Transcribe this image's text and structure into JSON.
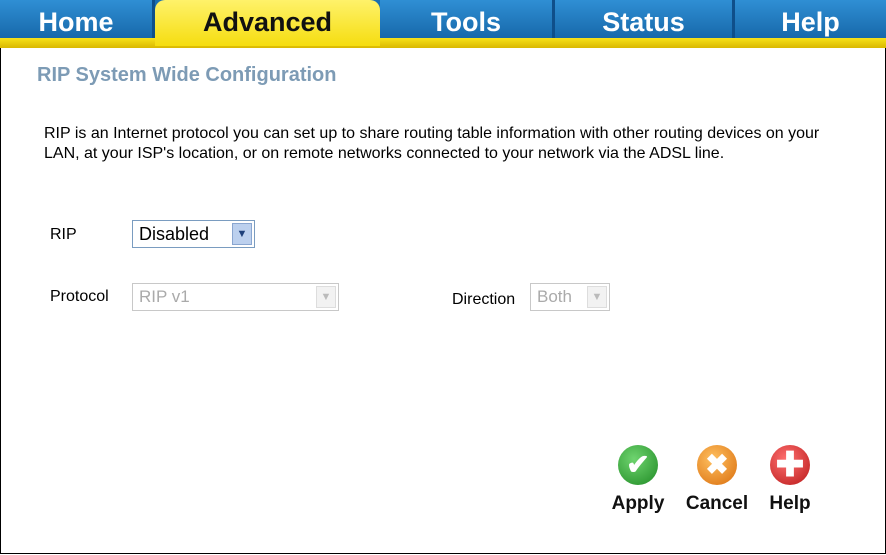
{
  "nav": {
    "tabs": [
      {
        "label": "Home"
      },
      {
        "label": "Advanced",
        "active": true
      },
      {
        "label": "Tools"
      },
      {
        "label": "Status"
      },
      {
        "label": "Help"
      }
    ]
  },
  "page": {
    "title": "RIP System Wide Configuration",
    "description": "RIP is an Internet protocol you can set up to share routing table information with other routing devices on your LAN, at your ISP's location, or on remote networks connected to your network via the ADSL line."
  },
  "form": {
    "rip_label": "RIP",
    "rip_value": "Disabled",
    "protocol_label": "Protocol",
    "protocol_value": "RIP v1",
    "direction_label": "Direction",
    "direction_value": "Both"
  },
  "buttons": {
    "apply": "Apply",
    "cancel": "Cancel",
    "help": "Help"
  },
  "icons": {
    "apply": "check-icon",
    "cancel": "x-icon",
    "help": "plus-icon",
    "dropdown": "chevron-down-icon"
  },
  "colors": {
    "tab_blue": "#1a6eb0",
    "tab_active": "#f5dd10",
    "title": "#7d9bb5",
    "apply": "#2e9e2e",
    "cancel": "#e8851a",
    "help": "#d42a2a"
  }
}
